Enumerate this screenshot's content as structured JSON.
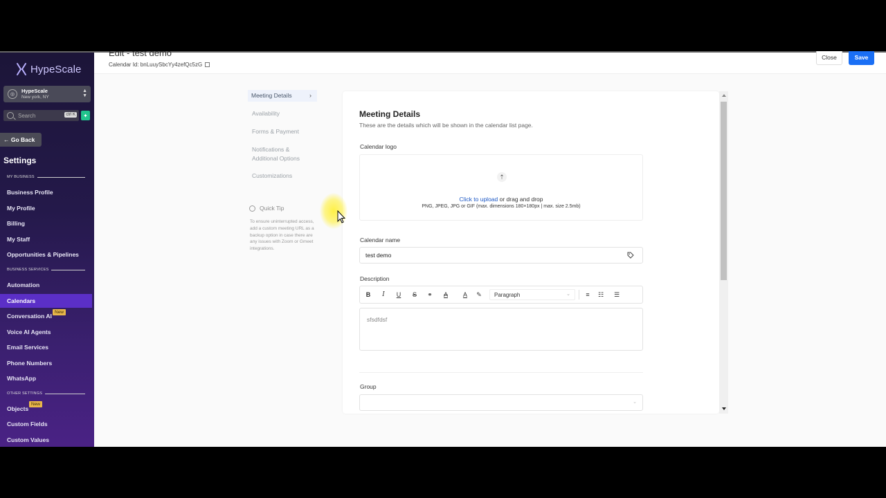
{
  "brand": {
    "name": "HypeScale"
  },
  "location": {
    "name": "HypeScale",
    "city": "New york, NY"
  },
  "search": {
    "placeholder": "Search",
    "shortcut": "ctrl K"
  },
  "sidebar": {
    "go_back": "← Go Back",
    "title": "Settings",
    "sections": {
      "my_business": "MY BUSINESS",
      "business_services": "BUSINESS SERVICES",
      "other_settings": "OTHER SETTINGS"
    },
    "items": {
      "business_profile": "Business Profile",
      "my_profile": "My Profile",
      "billing": "Billing",
      "my_staff": "My Staff",
      "opportunities": "Opportunities & Pipelines",
      "automation": "Automation",
      "calendars": "Calendars",
      "conversation_ai": "Conversation AI",
      "voice_ai": "Voice AI Agents",
      "email_services": "Email Services",
      "phone_numbers": "Phone Numbers",
      "whatsapp": "WhatsApp",
      "objects": "Objects",
      "custom_fields": "Custom Fields",
      "custom_values": "Custom Values"
    },
    "badge_new": "New"
  },
  "header": {
    "title": "Edit - test demo",
    "calendar_id": "Calendar Id: bnLuuySbcYy4zefQc5zG",
    "close": "Close",
    "save": "Save"
  },
  "tabs": {
    "meeting_details": "Meeting Details",
    "availability": "Availability",
    "forms_payment": "Forms & Payment",
    "notifications_1": "Notifications &",
    "notifications_2": "Additional Options",
    "customizations": "Customizations"
  },
  "quick_tip": {
    "title": "Quick Tip",
    "text": "To ensure uninterrupted access, add a custom meeting URL as a backup option in case there are any issues with Zoom or Gmeet integrations."
  },
  "form": {
    "title": "Meeting Details",
    "subtitle": "These are the details which will be shown in the calendar list page.",
    "logo_label": "Calendar logo",
    "upload_link": "Click to upload",
    "upload_rest": " or drag and drop",
    "upload_hint": "PNG, JPEG, JPG or GIF (max. dimensions 180×180px | max. size 2.5mb)",
    "name_label": "Calendar name",
    "name_value": "test demo",
    "description_label": "Description",
    "paragraph": "Paragraph",
    "description_value": "sfsdfdsf",
    "group_label": "Group"
  }
}
